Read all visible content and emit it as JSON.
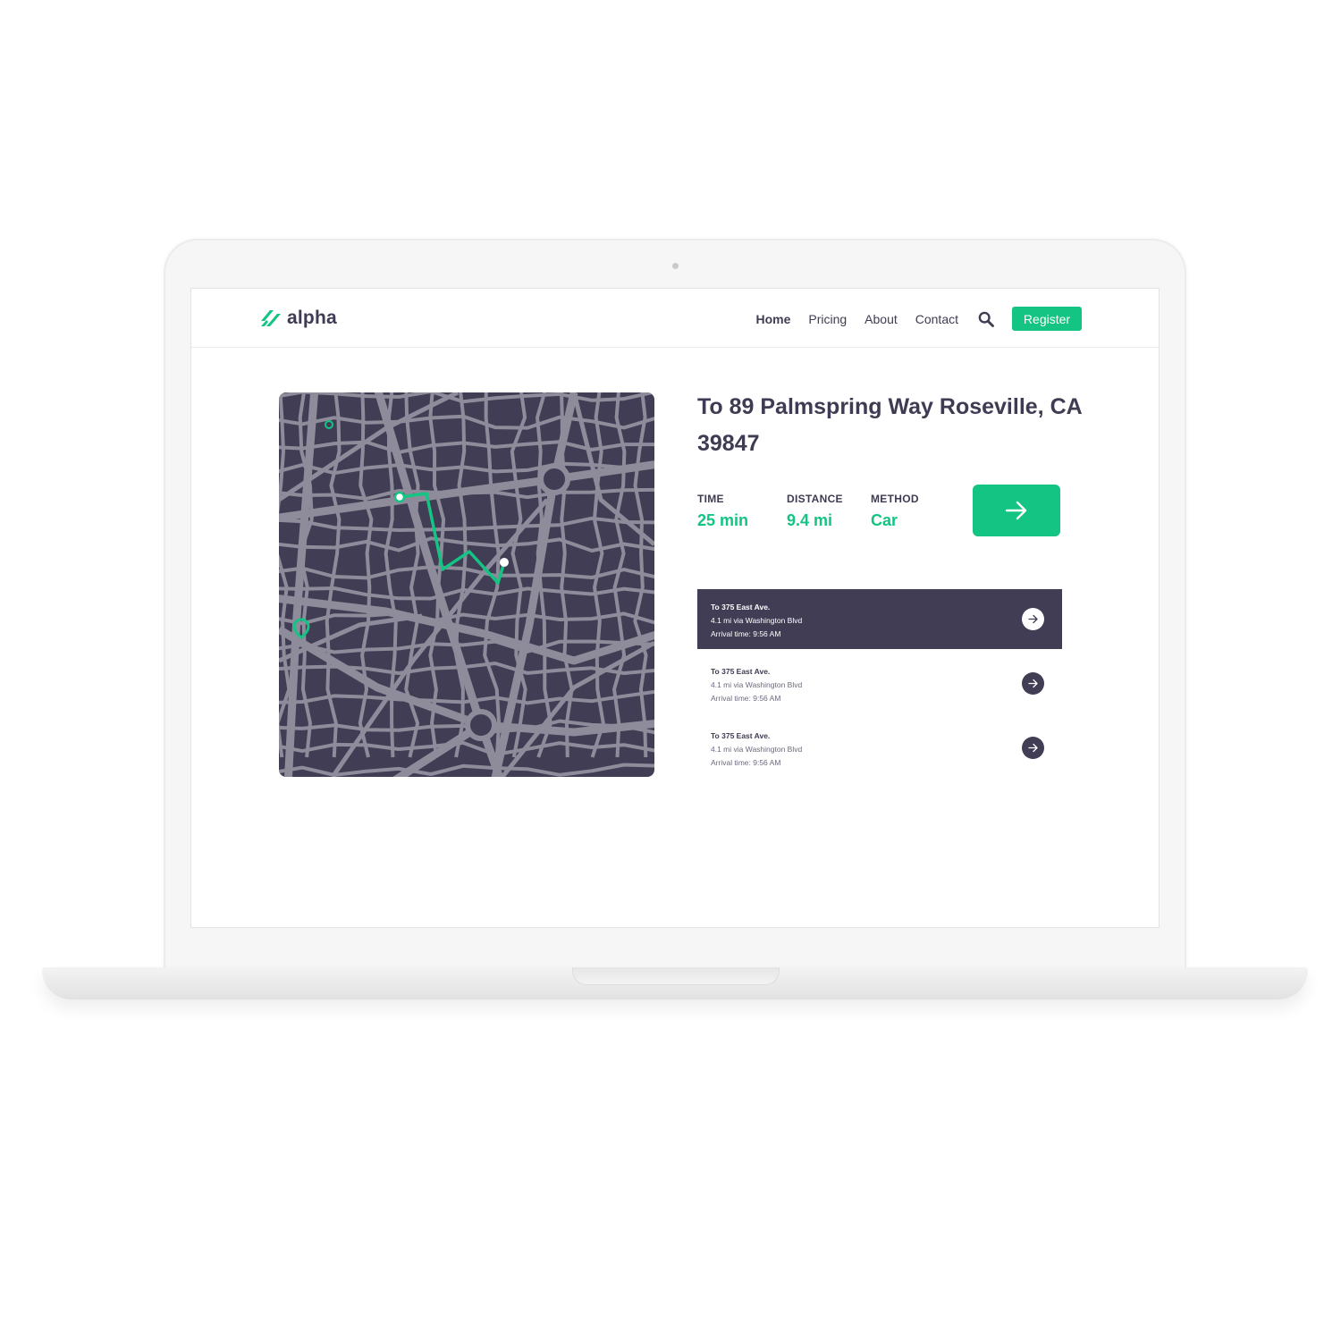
{
  "brand": {
    "name": "alpha",
    "accent": "#13c483",
    "dark": "#403d55"
  },
  "nav": {
    "items": [
      {
        "label": "Home",
        "active": true
      },
      {
        "label": "Pricing"
      },
      {
        "label": "About"
      },
      {
        "label": "Contact"
      }
    ],
    "search_icon": "search-icon",
    "register_label": "Register"
  },
  "trip": {
    "title": "To 89 Palmspring Way Roseville, CA 39847",
    "stats": [
      {
        "label": "TIME",
        "value": "25 min"
      },
      {
        "label": "DISTANCE",
        "value": "9.4 mi"
      },
      {
        "label": "METHOD",
        "value": "Car"
      }
    ],
    "go_icon": "arrow-right-icon"
  },
  "routes": [
    {
      "title": "To 375 East Ave.",
      "distance": "4.1 mi via Washington Blvd",
      "arrival": "Arrival time: 9:56 AM",
      "selected": true
    },
    {
      "title": "To 375 East Ave.",
      "distance": "4.1 mi via Washington Blvd",
      "arrival": "Arrival time: 9:56 AM",
      "selected": false
    },
    {
      "title": "To 375 East Ave.",
      "distance": "4.1 mi via Washington Blvd",
      "arrival": "Arrival time: 9:56 AM",
      "selected": false
    }
  ]
}
